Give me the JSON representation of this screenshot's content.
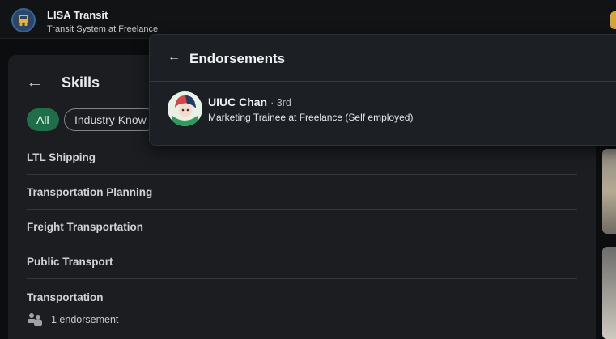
{
  "topbar": {
    "company_name": "LISA Transit",
    "company_subtitle": "Transit System at Freelance"
  },
  "skills": {
    "title": "Skills",
    "filters": [
      "All",
      "Industry Know"
    ],
    "rows": [
      "LTL Shipping",
      "Transportation Planning",
      "Freight Transportation",
      "Public Transport",
      "Transportation"
    ],
    "endorsement_summary": "1 endorsement"
  },
  "endorsements_popup": {
    "title": "Endorsements",
    "endorsers": [
      {
        "name": "UIUC Chan",
        "degree": "· 3rd",
        "headline": "Marketing Trainee at Freelance (Self employed)"
      }
    ]
  },
  "colors": {
    "accent_green": "#1f6e49",
    "panel_bg": "#1b1d20",
    "popup_bg": "#1c1f23"
  }
}
